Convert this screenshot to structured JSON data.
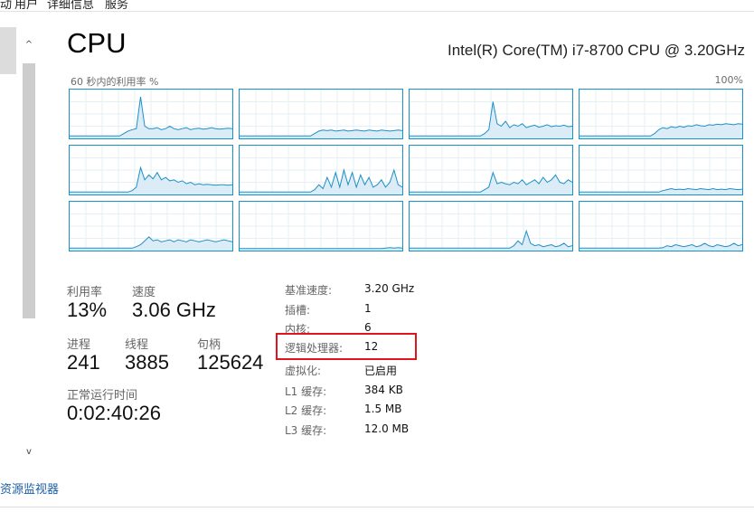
{
  "tabs": [
    "动",
    "用户",
    "详细信息",
    "服务"
  ],
  "sidebar": {
    "scroll_up": "^",
    "scroll_down": "v"
  },
  "footer_link": "资源监视器",
  "header": {
    "title": "CPU",
    "model": "Intel(R) Core(TM) i7-8700 CPU @ 3.20GHz",
    "graph_caption": "60 秒内的利用率 %",
    "graph_max": "100%"
  },
  "graphs": [
    [
      0.05,
      0.05,
      0.05,
      0.05,
      0.05,
      0.05,
      0.05,
      0.05,
      0.05,
      0.05,
      0.05,
      0.05,
      0.05,
      0.1,
      0.15,
      0.18,
      0.2,
      0.85,
      0.25,
      0.2,
      0.2,
      0.22,
      0.18,
      0.2,
      0.25,
      0.2,
      0.18,
      0.2,
      0.22,
      0.18,
      0.2,
      0.21,
      0.19,
      0.2,
      0.22,
      0.2,
      0.19,
      0.2,
      0.21,
      0.2
    ],
    [
      0.05,
      0.05,
      0.05,
      0.05,
      0.05,
      0.05,
      0.05,
      0.05,
      0.05,
      0.05,
      0.05,
      0.05,
      0.05,
      0.05,
      0.05,
      0.05,
      0.05,
      0.05,
      0.1,
      0.15,
      0.17,
      0.16,
      0.17,
      0.15,
      0.16,
      0.17,
      0.15,
      0.16,
      0.17,
      0.16,
      0.15,
      0.17,
      0.16,
      0.15,
      0.17,
      0.16,
      0.15,
      0.16,
      0.17,
      0.16
    ],
    [
      0.05,
      0.05,
      0.05,
      0.05,
      0.05,
      0.05,
      0.05,
      0.05,
      0.05,
      0.05,
      0.05,
      0.05,
      0.05,
      0.05,
      0.05,
      0.05,
      0.05,
      0.05,
      0.1,
      0.18,
      0.75,
      0.3,
      0.25,
      0.35,
      0.22,
      0.28,
      0.25,
      0.3,
      0.22,
      0.25,
      0.27,
      0.23,
      0.25,
      0.28,
      0.24,
      0.26,
      0.25,
      0.27,
      0.24,
      0.25
    ],
    [
      0.05,
      0.05,
      0.05,
      0.05,
      0.05,
      0.05,
      0.05,
      0.05,
      0.05,
      0.05,
      0.05,
      0.05,
      0.05,
      0.05,
      0.05,
      0.05,
      0.05,
      0.05,
      0.1,
      0.18,
      0.22,
      0.2,
      0.24,
      0.22,
      0.25,
      0.23,
      0.26,
      0.25,
      0.28,
      0.26,
      0.25,
      0.28,
      0.27,
      0.29,
      0.28,
      0.3,
      0.29,
      0.28,
      0.3,
      0.29
    ],
    [
      0.05,
      0.05,
      0.05,
      0.05,
      0.05,
      0.05,
      0.05,
      0.05,
      0.05,
      0.05,
      0.05,
      0.05,
      0.05,
      0.05,
      0.05,
      0.08,
      0.15,
      0.55,
      0.3,
      0.4,
      0.32,
      0.45,
      0.3,
      0.35,
      0.28,
      0.3,
      0.25,
      0.28,
      0.22,
      0.25,
      0.2,
      0.22,
      0.2,
      0.21,
      0.2,
      0.19,
      0.2,
      0.2,
      0.19,
      0.2
    ],
    [
      0.05,
      0.05,
      0.05,
      0.05,
      0.05,
      0.05,
      0.05,
      0.05,
      0.05,
      0.05,
      0.05,
      0.05,
      0.05,
      0.05,
      0.05,
      0.05,
      0.05,
      0.05,
      0.1,
      0.2,
      0.12,
      0.35,
      0.15,
      0.45,
      0.15,
      0.5,
      0.2,
      0.45,
      0.15,
      0.4,
      0.2,
      0.35,
      0.15,
      0.2,
      0.3,
      0.15,
      0.25,
      0.5,
      0.2,
      0.15
    ],
    [
      0.05,
      0.05,
      0.05,
      0.05,
      0.05,
      0.05,
      0.05,
      0.05,
      0.05,
      0.05,
      0.05,
      0.05,
      0.05,
      0.05,
      0.05,
      0.05,
      0.05,
      0.05,
      0.1,
      0.15,
      0.45,
      0.22,
      0.25,
      0.22,
      0.2,
      0.25,
      0.22,
      0.3,
      0.2,
      0.25,
      0.3,
      0.22,
      0.35,
      0.25,
      0.3,
      0.4,
      0.25,
      0.22,
      0.3,
      0.25
    ],
    [
      0.05,
      0.05,
      0.05,
      0.05,
      0.05,
      0.05,
      0.05,
      0.05,
      0.05,
      0.05,
      0.05,
      0.05,
      0.05,
      0.05,
      0.05,
      0.05,
      0.05,
      0.05,
      0.05,
      0.05,
      0.08,
      0.1,
      0.12,
      0.1,
      0.11,
      0.1,
      0.12,
      0.11,
      0.1,
      0.12,
      0.11,
      0.1,
      0.12,
      0.1,
      0.11,
      0.1,
      0.12,
      0.11,
      0.1,
      0.11
    ],
    [
      0.05,
      0.05,
      0.05,
      0.05,
      0.05,
      0.05,
      0.05,
      0.05,
      0.05,
      0.05,
      0.05,
      0.05,
      0.05,
      0.05,
      0.05,
      0.05,
      0.08,
      0.12,
      0.2,
      0.28,
      0.2,
      0.22,
      0.18,
      0.2,
      0.22,
      0.18,
      0.22,
      0.2,
      0.18,
      0.22,
      0.2,
      0.18,
      0.2,
      0.22,
      0.2,
      0.18,
      0.2,
      0.22,
      0.2,
      0.18
    ],
    [
      0.04,
      0.04,
      0.04,
      0.04,
      0.04,
      0.04,
      0.04,
      0.04,
      0.04,
      0.04,
      0.04,
      0.04,
      0.04,
      0.04,
      0.04,
      0.04,
      0.04,
      0.04,
      0.04,
      0.04,
      0.04,
      0.04,
      0.04,
      0.04,
      0.04,
      0.04,
      0.04,
      0.04,
      0.04,
      0.04,
      0.04,
      0.04,
      0.04,
      0.04,
      0.04,
      0.05,
      0.06,
      0.05,
      0.06,
      0.05
    ],
    [
      0.05,
      0.05,
      0.05,
      0.05,
      0.05,
      0.05,
      0.05,
      0.05,
      0.05,
      0.05,
      0.05,
      0.05,
      0.05,
      0.05,
      0.05,
      0.05,
      0.05,
      0.05,
      0.05,
      0.05,
      0.05,
      0.05,
      0.05,
      0.05,
      0.05,
      0.1,
      0.2,
      0.12,
      0.4,
      0.15,
      0.1,
      0.12,
      0.08,
      0.1,
      0.12,
      0.08,
      0.1,
      0.15,
      0.08,
      0.1
    ],
    [
      0.05,
      0.05,
      0.05,
      0.05,
      0.05,
      0.05,
      0.05,
      0.05,
      0.05,
      0.05,
      0.05,
      0.05,
      0.05,
      0.05,
      0.05,
      0.05,
      0.05,
      0.05,
      0.05,
      0.05,
      0.06,
      0.1,
      0.08,
      0.12,
      0.1,
      0.08,
      0.1,
      0.12,
      0.08,
      0.1,
      0.15,
      0.1,
      0.08,
      0.12,
      0.1,
      0.08,
      0.1,
      0.15,
      0.1,
      0.12
    ]
  ],
  "stats": {
    "util_label": "利用率",
    "util_value": "13%",
    "speed_label": "速度",
    "speed_value": "3.06 GHz",
    "proc_label": "进程",
    "proc_value": "241",
    "thread_label": "线程",
    "thread_value": "3885",
    "handle_label": "句柄",
    "handle_value": "125624",
    "uptime_label": "正常运行时间",
    "uptime_value": "0:02:40:26"
  },
  "specs": [
    {
      "k": "基准速度:",
      "v": "3.20 GHz"
    },
    {
      "k": "插槽:",
      "v": "1"
    },
    {
      "k": "内核:",
      "v": "6"
    },
    {
      "k": "逻辑处理器:",
      "v": "12"
    },
    {
      "k": "虚拟化:",
      "v": "已启用"
    },
    {
      "k": "L1 缓存:",
      "v": "384 KB"
    },
    {
      "k": "L2 缓存:",
      "v": "1.5 MB"
    },
    {
      "k": "L3 缓存:",
      "v": "12.0 MB"
    }
  ],
  "colors": {
    "graph_line": "#1b90c8",
    "graph_fill": "#dcecf6",
    "highlight": "#e0141c",
    "link": "#1a5ea8"
  }
}
